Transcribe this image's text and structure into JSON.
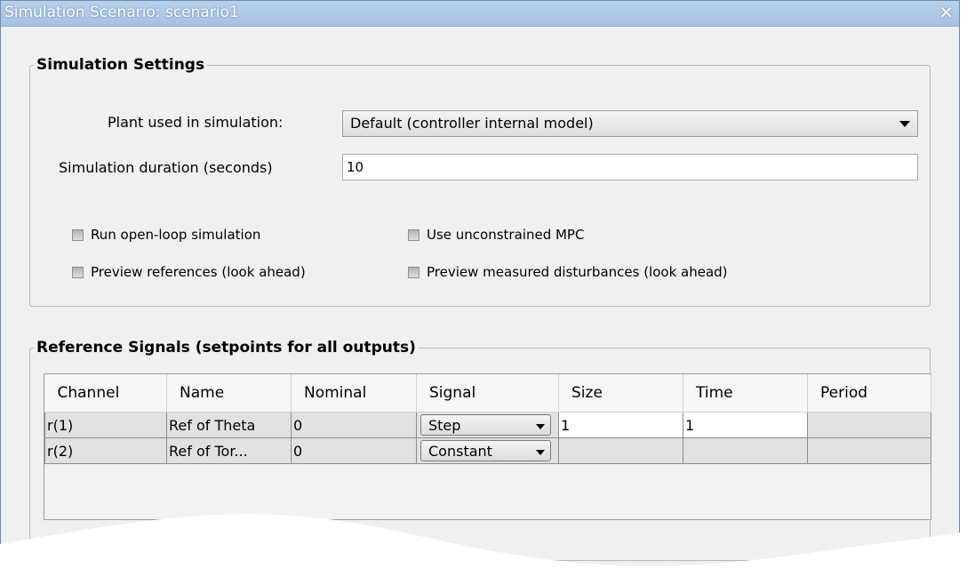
{
  "window": {
    "title": "Simulation Scenario: scenario1",
    "close_glyph": "✕"
  },
  "settings": {
    "legend": "Simulation Settings",
    "plant_label": "Plant used in simulation:",
    "plant_value": "Default (controller internal model)",
    "duration_label": "Simulation duration (seconds)",
    "duration_value": "10",
    "checkboxes": [
      {
        "label": "Run open-loop simulation",
        "checked": false
      },
      {
        "label": "Use unconstrained MPC",
        "checked": false
      },
      {
        "label": "Preview references (look ahead)",
        "checked": false
      },
      {
        "label": "Preview measured disturbances (look ahead)",
        "checked": false
      }
    ]
  },
  "reference": {
    "legend": "Reference Signals (setpoints for all outputs)",
    "columns": [
      "Channel",
      "Name",
      "Nominal",
      "Signal",
      "Size",
      "Time",
      "Period"
    ],
    "rows": [
      {
        "channel": "r(1)",
        "name": "Ref of Theta",
        "nominal": "0",
        "signal": "Step",
        "size": "1",
        "time": "1",
        "period": ""
      },
      {
        "channel": "r(2)",
        "name": "Ref of Tor...",
        "nominal": "0",
        "signal": "Constant",
        "size": "",
        "time": "",
        "period": ""
      }
    ]
  },
  "icons": {
    "dropdown": "chevron-down-icon",
    "close": "close-icon",
    "checkbox": "checkbox-unchecked-icon"
  }
}
